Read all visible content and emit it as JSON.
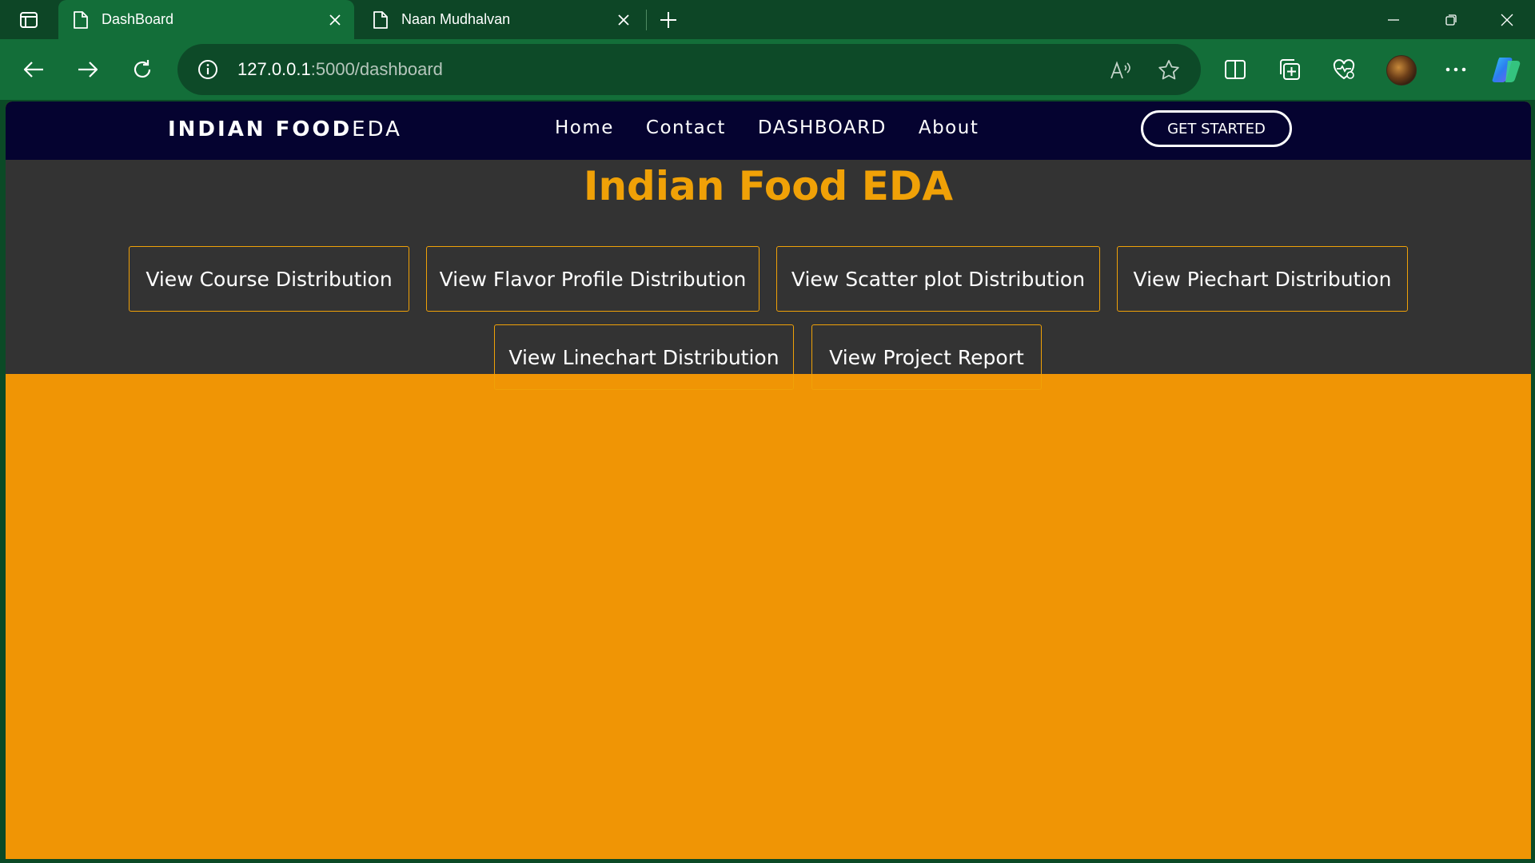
{
  "browser": {
    "tabs": [
      {
        "title": "DashBoard",
        "active": true
      },
      {
        "title": "Naan Mudhalvan",
        "active": false
      }
    ],
    "address": {
      "host": "127.0.0.1",
      "path": ":5000/dashboard"
    },
    "icons": [
      "tab-actions-icon",
      "page-icon",
      "close-icon",
      "new-tab-icon",
      "minimize-icon",
      "restore-icon",
      "window-close-icon",
      "back-icon",
      "forward-icon",
      "refresh-icon",
      "info-icon",
      "read-aloud-icon",
      "favorite-star-icon",
      "split-screen-icon",
      "collections-icon",
      "browser-essentials-icon",
      "profile-avatar",
      "more-icon",
      "copilot-icon"
    ]
  },
  "site": {
    "brand_bold": "INDIAN FOOD",
    "brand_light": "EDA",
    "nav": [
      {
        "label": "Home"
      },
      {
        "label": "Contact"
      },
      {
        "label": "DASHBOARD"
      },
      {
        "label": "About"
      }
    ],
    "cta": "GET STARTED"
  },
  "dashboard": {
    "title": "Indian Food EDA",
    "buttons": [
      {
        "label": "View Course Distribution"
      },
      {
        "label": "View Flavor Profile Distribution"
      },
      {
        "label": "View Scatter plot Distribution"
      },
      {
        "label": "View Piechart Distribution"
      },
      {
        "label": "View Linechart Distribution"
      },
      {
        "label": "View Project Report"
      }
    ]
  },
  "colors": {
    "accent": "#f0a107",
    "content_background": "#f09505",
    "nav_background": "#050330",
    "panel_background": "#333333",
    "browser_frame": "#136e39"
  }
}
